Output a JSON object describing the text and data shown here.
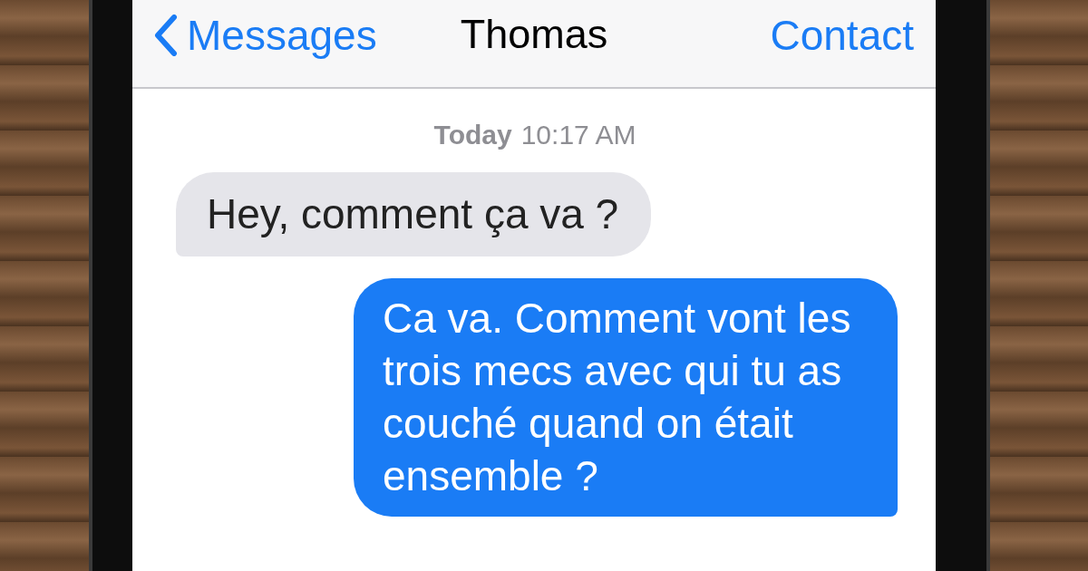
{
  "nav": {
    "back": "Messages",
    "title": "Thomas",
    "action": "Contact"
  },
  "timestamp": {
    "day": "Today",
    "time": "10:17 AM"
  },
  "messages": [
    {
      "kind": "received",
      "text": "Hey, comment ça va ?"
    },
    {
      "kind": "sent",
      "text": "Ca va. Comment vont les trois mecs avec qui tu as couché quand on était ensemble ?"
    }
  ]
}
